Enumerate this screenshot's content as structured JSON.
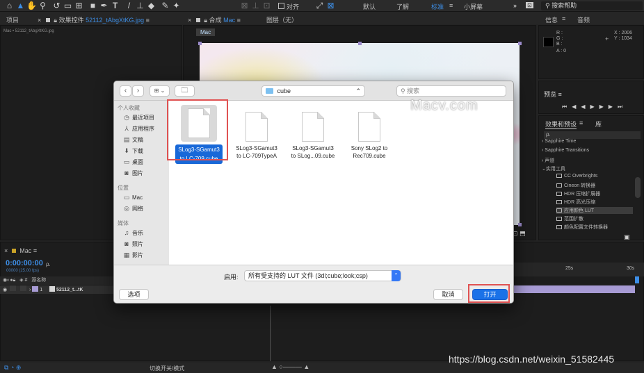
{
  "toolbar": {
    "align_label": "对齐",
    "workspaces": [
      "默认",
      "了解",
      "标准",
      "小屏幕"
    ],
    "active_workspace": "标准",
    "search_placeholder": "搜索帮助"
  },
  "project_panel": {
    "tab_project": "项目",
    "tab_effect_controls_prefix": "效果控件",
    "tab_effect_controls_file": "52112_tAbgXtKG.jpg",
    "breadcrumb": "Mac • 52112_tAbgXtKG.jpg"
  },
  "comp_panel": {
    "tab_comp_prefix": "合成",
    "tab_comp_name": "Mac",
    "tab_layer": "图层（无）",
    "comp_badge": "Mac"
  },
  "info_panel": {
    "tab_info": "信息",
    "tab_audio": "音频",
    "r": "R :",
    "g": "G :",
    "b": "B :",
    "a": "A : 0",
    "x": "X : 2006",
    "y": "Y : 1034"
  },
  "preview_panel": {
    "title": "预览"
  },
  "effects_panel": {
    "tab_effects": "效果和预设",
    "tab_library": "库",
    "search_placeholder": "ρ.",
    "categories": [
      "Sapphire Time",
      "Sapphire Transitions",
      "声道",
      "实用工具"
    ],
    "items": [
      "CC Overbrights",
      "Cineon 转换器",
      "HDR 压缩扩展器",
      "HDR 高光压缩",
      "应用颜色 LUT",
      "范围扩散",
      "颜色配置文件转换器"
    ],
    "selected_item": "应用颜色 LUT"
  },
  "timeline": {
    "tab_name": "Mac",
    "timecode": "0:00:00:00",
    "fps": "00000 (25.00 fps)",
    "search_placeholder": "ρ.",
    "col_source": "源名称",
    "layer_index": "1",
    "layer_name": "52112_t...tK",
    "ruler_mark": "25s",
    "ruler_mark2": "30s",
    "bottom_toggle": "切换开关/模式"
  },
  "dialog": {
    "location": "cube",
    "search_placeholder": "搜索",
    "sidebar": {
      "favorites_header": "个人收藏",
      "favorites": [
        {
          "icon": "recents-icon",
          "glyph": "◷",
          "label": "最近项目"
        },
        {
          "icon": "applications-icon",
          "glyph": "⅄",
          "label": "应用程序"
        },
        {
          "icon": "documents-icon",
          "glyph": "▤",
          "label": "文稿"
        },
        {
          "icon": "downloads-icon",
          "glyph": "⬇",
          "label": "下载"
        },
        {
          "icon": "desktop-icon",
          "glyph": "▭",
          "label": "桌面"
        },
        {
          "icon": "pictures-icon",
          "glyph": "◙",
          "label": "图片"
        }
      ],
      "locations_header": "位置",
      "locations": [
        {
          "icon": "computer-icon",
          "glyph": "▭",
          "label": "Mac"
        },
        {
          "icon": "network-icon",
          "glyph": "◎",
          "label": "网络"
        }
      ],
      "media_header": "媒体",
      "media": [
        {
          "icon": "music-icon",
          "glyph": "♫",
          "label": "音乐"
        },
        {
          "icon": "photos-icon",
          "glyph": "◙",
          "label": "照片"
        },
        {
          "icon": "movies-icon",
          "glyph": "▦",
          "label": "影片"
        }
      ]
    },
    "files": [
      {
        "line1": "SLog3-SGamut3",
        "line2": "to LC-709.cube",
        "selected": true
      },
      {
        "line1": "SLog3-SGamut3",
        "line2": "to LC-709TypeA",
        "selected": false
      },
      {
        "line1": "SLog3-SGamut3",
        "line2": "to SLog...09.cube",
        "selected": false
      },
      {
        "line1": "Sony SLog2 to",
        "line2": "Rec709.cube",
        "selected": false
      }
    ],
    "enable_label": "启用:",
    "enable_value": "所有受支持的 LUT 文件 (3dl;cube;look;csp)",
    "options_button": "选项",
    "cancel_button": "取消",
    "open_button": "打开"
  },
  "watermark": "Macv.com",
  "footer_url": "https://blog.csdn.net/weixin_51582445",
  "colors": {
    "accent_blue": "#3d8ee6",
    "highlight_red": "#e05252",
    "selection_blue": "#1868d8"
  }
}
